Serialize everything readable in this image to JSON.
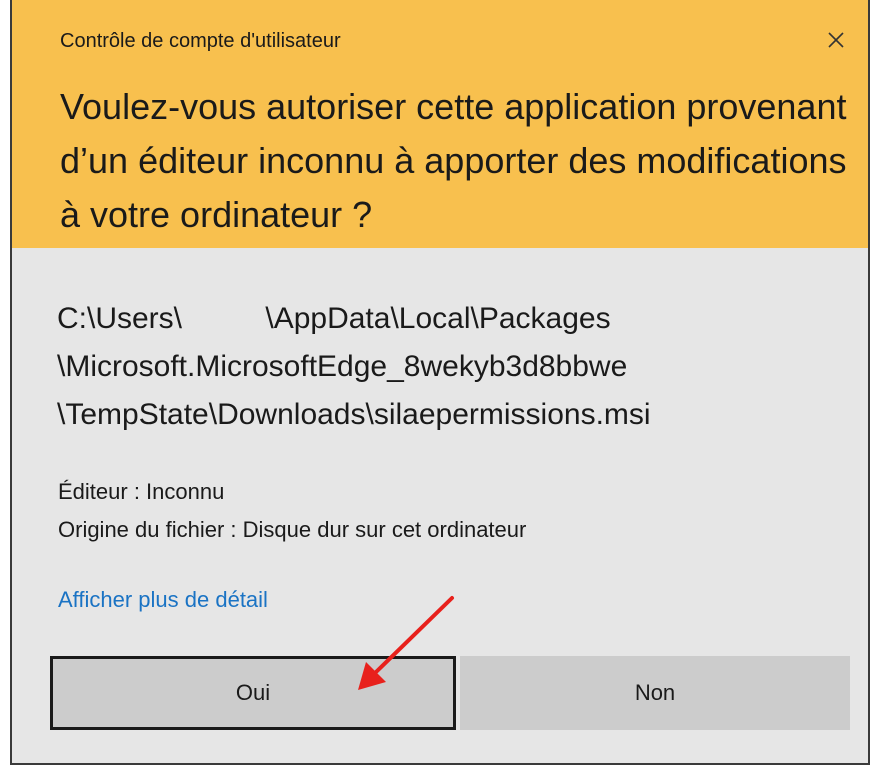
{
  "dialog": {
    "window_title": "Contrôle de compte d'utilisateur",
    "question": "Voulez-vous autoriser cette application provenant d’un éditeur inconnu à apporter des modifications à votre ordinateur ?",
    "path_lines": [
      "C:\\Users\\          \\AppData\\Local\\Packages",
      "\\Microsoft.MicrosoftEdge_8wekyb3d8bbwe",
      "\\TempState\\Downloads\\silaepermissions.msi"
    ],
    "publisher": "Éditeur : Inconnu",
    "file_origin": "Origine du fichier : Disque dur sur cet ordinateur",
    "details_link": "Afficher plus de détail",
    "yes_label": "Oui",
    "no_label": "Non"
  },
  "icons": {
    "close": "close-icon",
    "annotation": "red-arrow-icon"
  },
  "colors": {
    "header_bg": "#f8c04e",
    "body_bg": "#e6e6e6",
    "button_bg": "#cccccc",
    "link": "#1a73c4",
    "arrow": "#e8211c"
  }
}
